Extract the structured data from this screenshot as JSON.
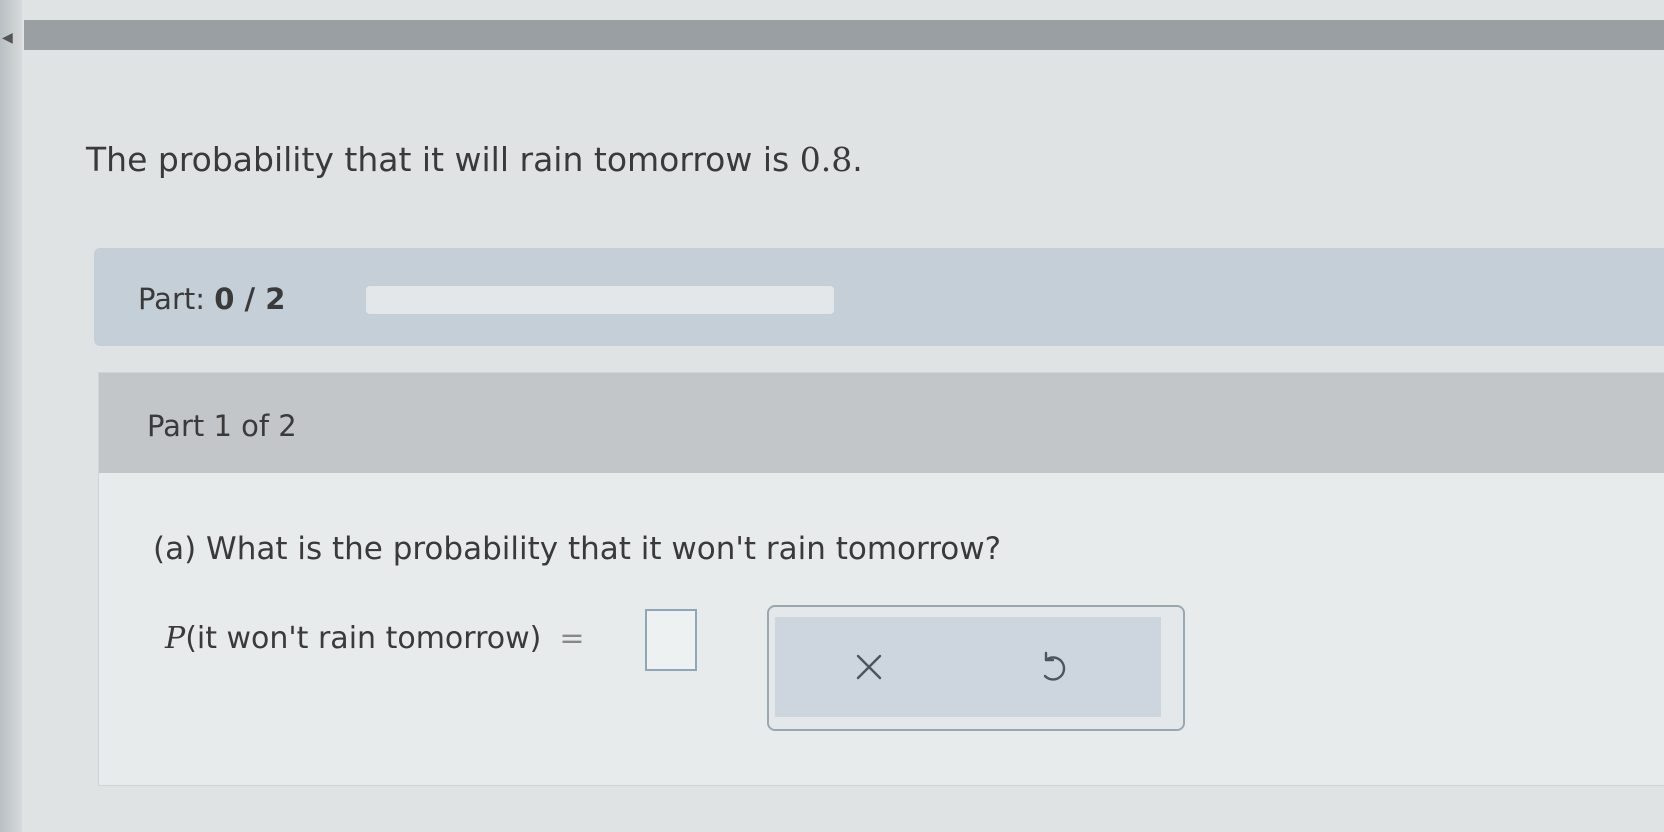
{
  "problem": {
    "statement_prefix": "The probability that it will rain tomorrow is ",
    "statement_value": "0.8",
    "statement_suffix": "."
  },
  "progress": {
    "label": "Part:",
    "completed": "0",
    "separator": " / ",
    "total": "2",
    "fraction_complete": 0
  },
  "part": {
    "header": "Part 1 of 2",
    "question": "(a) What is the probability that it won't rain tomorrow?",
    "equation_p": "P",
    "equation_arg": "(it won't rain tomorrow)",
    "equals": "=",
    "answer_value": ""
  },
  "tools": {
    "clear_icon": "x-icon",
    "undo_icon": "undo-icon"
  },
  "colors": {
    "progress_bar_bg": "#c5cfd8",
    "part_header_bg": "#c2c6c9",
    "tools_bg": "#cdd6de"
  }
}
